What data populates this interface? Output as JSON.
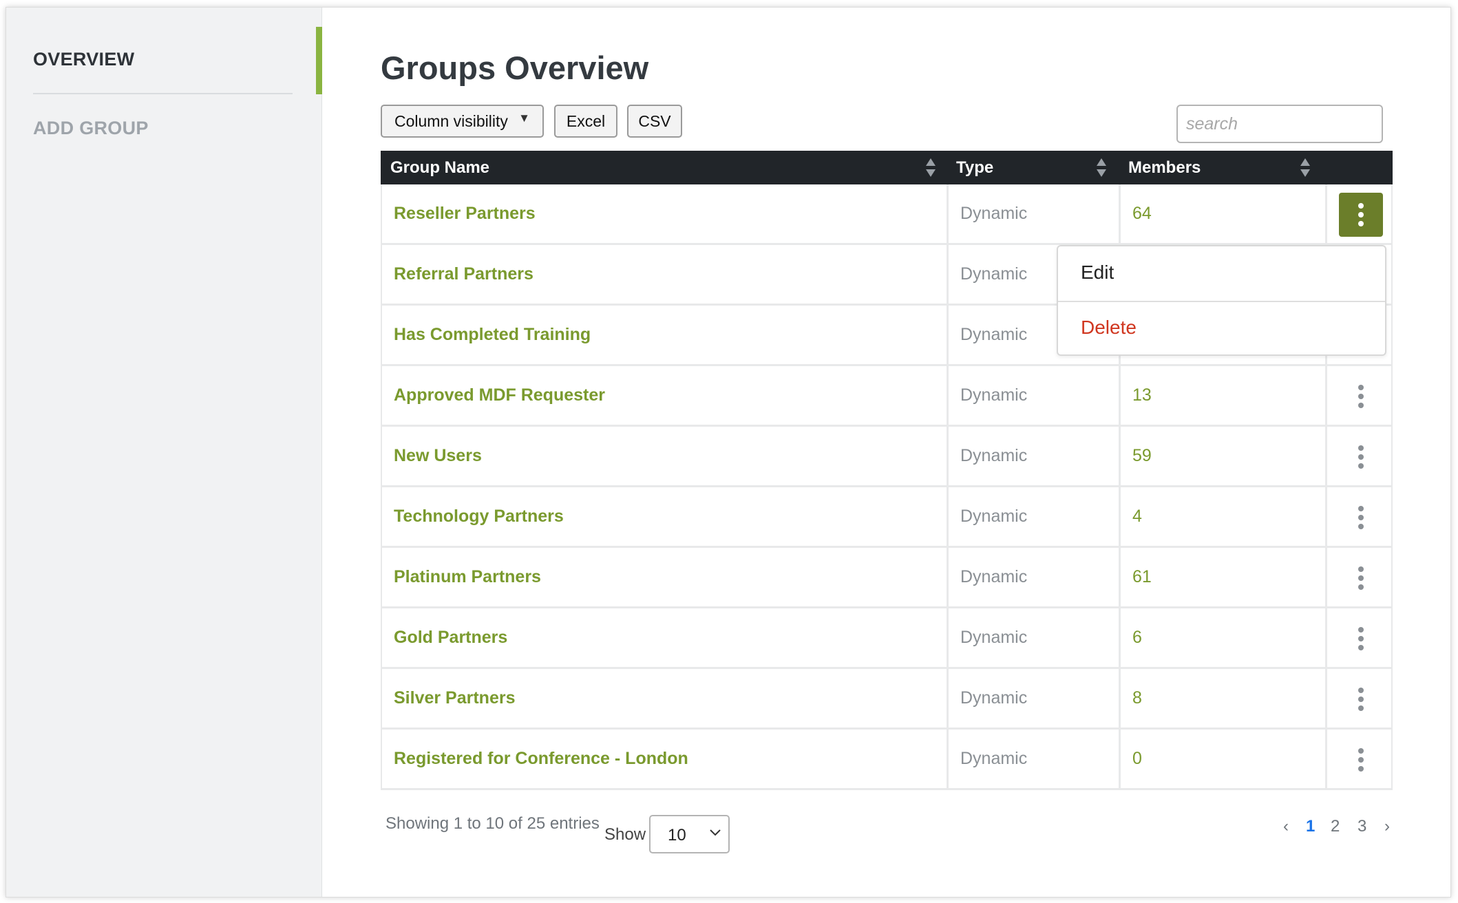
{
  "sidebar": {
    "items": [
      {
        "label": "OVERVIEW",
        "active": true
      },
      {
        "label": "ADD GROUP",
        "active": false
      }
    ],
    "accent_color": "#8ab440"
  },
  "page": {
    "title": "Groups Overview"
  },
  "toolbar": {
    "column_visibility_label": "Column visibility",
    "excel_label": "Excel",
    "csv_label": "CSV",
    "search_placeholder": "search"
  },
  "table": {
    "headers": [
      "Group Name",
      "Type",
      "Members"
    ],
    "rows": [
      {
        "name": "Reseller Partners",
        "type": "Dynamic",
        "members": "64"
      },
      {
        "name": "Referral Partners",
        "type": "Dynamic",
        "members": ""
      },
      {
        "name": "Has Completed Training",
        "type": "Dynamic",
        "members": ""
      },
      {
        "name": "Approved MDF Requester",
        "type": "Dynamic",
        "members": "13"
      },
      {
        "name": "New Users",
        "type": "Dynamic",
        "members": "59"
      },
      {
        "name": "Technology Partners",
        "type": "Dynamic",
        "members": "4"
      },
      {
        "name": "Platinum Partners",
        "type": "Dynamic",
        "members": "61"
      },
      {
        "name": "Gold Partners",
        "type": "Dynamic",
        "members": "6"
      },
      {
        "name": "Silver Partners",
        "type": "Dynamic",
        "members": "8"
      },
      {
        "name": "Registered for Conference - London",
        "type": "Dynamic",
        "members": "0"
      }
    ],
    "link_color": "#7a9a2e",
    "active_action_color": "#6b7e2a"
  },
  "row_menu": {
    "open_for_row": 0,
    "edit_label": "Edit",
    "delete_label": "Delete",
    "delete_color": "#d0361f"
  },
  "footer": {
    "info": "Showing 1 to 10 of 25 entries",
    "show_label": "Show",
    "page_size": "10",
    "pages": [
      "1",
      "2",
      "3"
    ],
    "current_page": "1",
    "prev_symbol": "‹",
    "next_symbol": "›"
  }
}
